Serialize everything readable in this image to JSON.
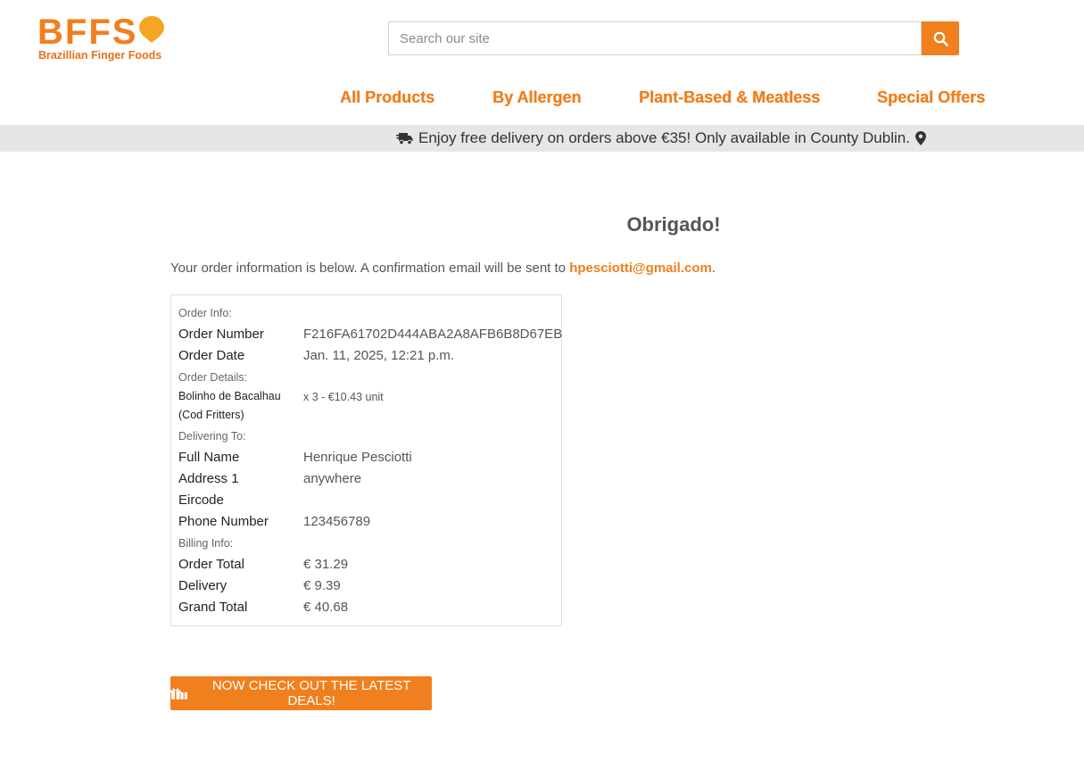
{
  "brand": {
    "logo_letters": "BFFS",
    "logo_tagline": "Brazillian Finger Foods",
    "accent_color": "#f07f1e"
  },
  "search": {
    "placeholder": "Search our site",
    "icon": "search-icon"
  },
  "nav": {
    "items": [
      {
        "label": "All Products"
      },
      {
        "label": "By Allergen"
      },
      {
        "label": "Plant-Based & Meatless"
      },
      {
        "label": "Special Offers"
      }
    ]
  },
  "promo": {
    "text": "Enjoy free delivery on orders above €35! Only available in County Dublin.",
    "left_icon": "truck-fast-icon",
    "right_icon": "map-marker-icon"
  },
  "confirmation": {
    "title": "Obrigado!",
    "intro_prefix": "Your order information is below. A confirmation email will be sent to",
    "email": "hpesciotti@gmail.com",
    "intro_suffix": "."
  },
  "order": {
    "order_info_label": "Order Info:",
    "order_number_label": "Order Number",
    "order_number": "F216FA61702D444ABA2A8AFB6B8D67EB",
    "order_date_label": "Order Date",
    "order_date": "Jan. 11, 2025, 12:21 p.m.",
    "order_details_label": "Order Details:",
    "item_name": "Bolinho de Bacalhau (Cod Fritters)",
    "item_qty": "x 3 - €10.43 unit",
    "delivering_label": "Delivering To:",
    "full_name_label": "Full Name",
    "full_name": "Henrique Pesciotti",
    "address1_label": "Address 1",
    "address1": "anywhere",
    "eircode_label": "Eircode",
    "eircode": "",
    "phone_label": "Phone Number",
    "phone": "123456789",
    "billing_label": "Billing Info:",
    "order_total_label": "Order Total",
    "order_total": "€ 31.29",
    "delivery_label": "Delivery",
    "delivery": "€ 9.39",
    "grand_total_label": "Grand Total",
    "grand_total": "€ 40.68"
  },
  "cta": {
    "label": "NOW CHECK OUT THE LATEST DEALS!",
    "icon": "gifts-icon"
  }
}
